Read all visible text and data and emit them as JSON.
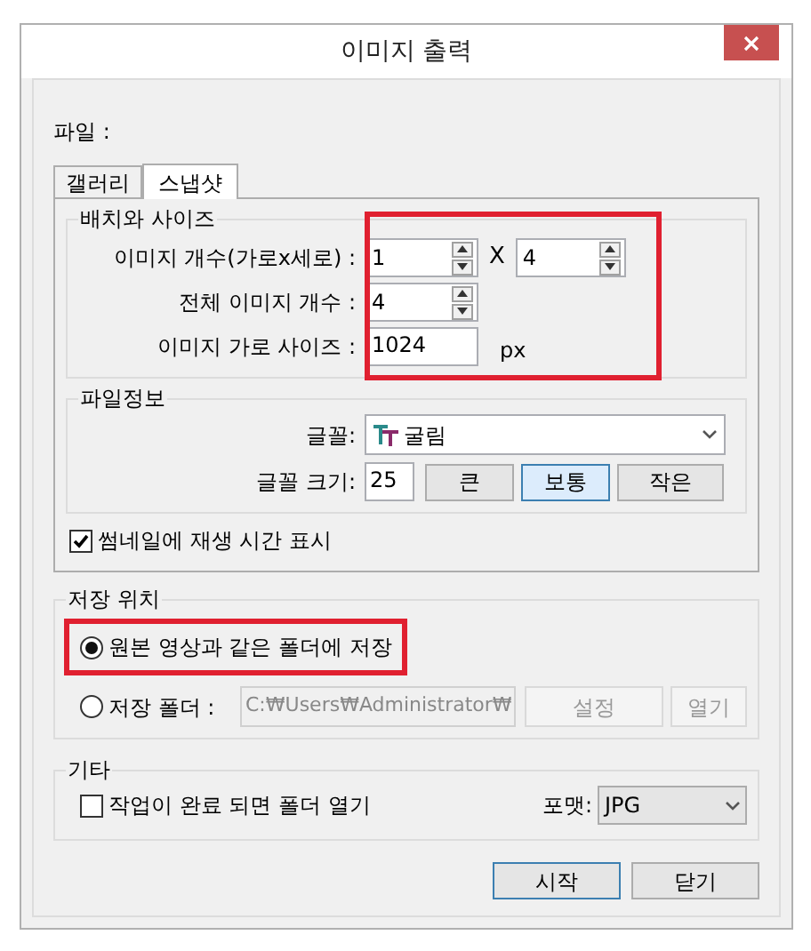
{
  "window": {
    "title": "이미지 출력"
  },
  "file_label": "파일 :",
  "tabs": [
    {
      "label": "갤러리",
      "selected": false
    },
    {
      "label": "스냅샷",
      "selected": true
    }
  ],
  "layout_group": {
    "title": "배치와 사이즈",
    "highlighted": true,
    "rows": [
      {
        "kind": "spin_pair",
        "label": "이미지 개수(가로x세로) :",
        "values": [
          "1",
          "4"
        ],
        "separator": "X"
      },
      {
        "kind": "spin",
        "label": "전체 이미지 개수 :",
        "value": "4"
      },
      {
        "kind": "text",
        "label": "이미지 가로 사이즈 :",
        "value": "1024",
        "unit": "px"
      }
    ]
  },
  "file_info": {
    "title": "파일정보",
    "font_label": "글꼴:",
    "font_value": "굴림",
    "size_label": "글꼴 크기:",
    "size_value": "25",
    "size_buttons": [
      {
        "label": "큰",
        "selected": false
      },
      {
        "label": "보통",
        "selected": true
      },
      {
        "label": "작은",
        "selected": false
      }
    ]
  },
  "show_time": {
    "label": "썸네일에 재생 시간 표시",
    "checked": true
  },
  "save_location": {
    "title": "저장 위치",
    "options": [
      {
        "kind": "same_folder",
        "label": "원본 영상과 같은 폴더에 저장",
        "selected": true,
        "highlighted": true
      },
      {
        "kind": "folder",
        "label": "저장 폴더 :",
        "selected": false,
        "path": "C:₩Users₩Administrator₩",
        "buttons": [
          {
            "label": "설정",
            "disabled": true
          },
          {
            "label": "열기",
            "disabled": true
          }
        ]
      }
    ]
  },
  "other": {
    "title": "기타",
    "open_folder": {
      "label": "작업이 완료 되면 폴더 열기",
      "checked": false
    },
    "format_label": "포맷:",
    "format_value": "JPG"
  },
  "buttons": [
    {
      "label": "시작",
      "default": true
    },
    {
      "label": "닫기",
      "default": false
    }
  ]
}
